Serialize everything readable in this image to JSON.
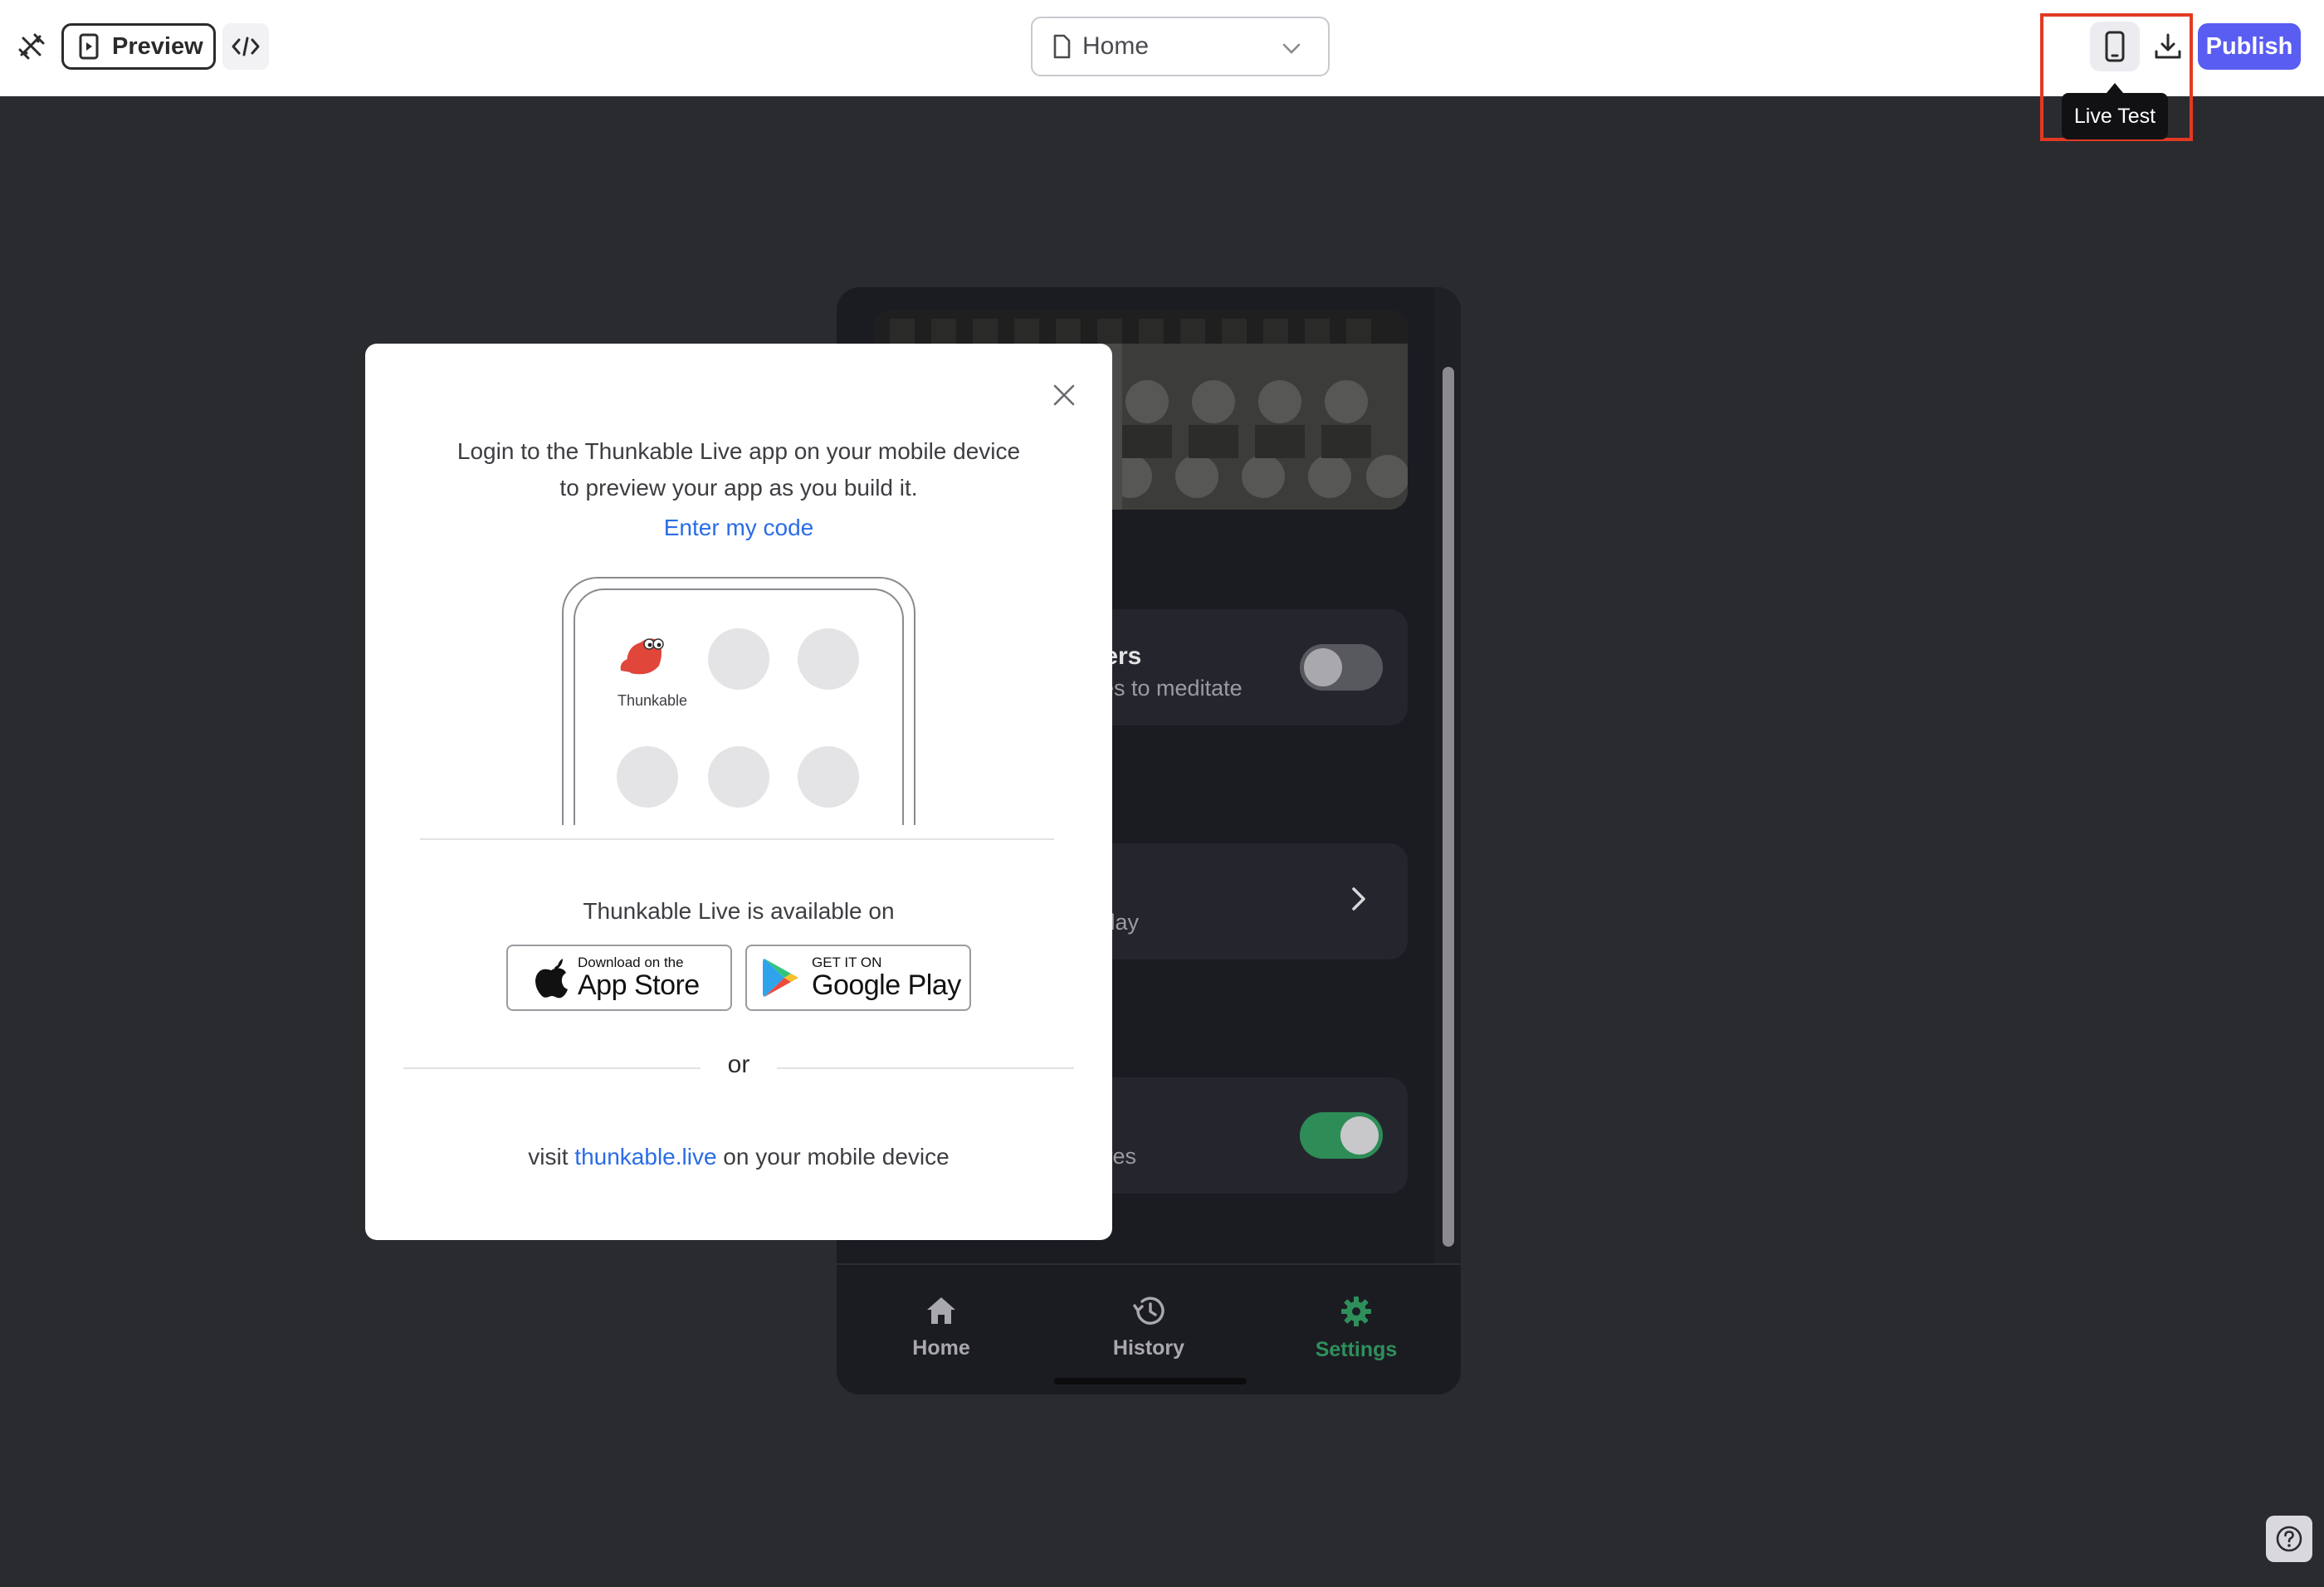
{
  "toolbar": {
    "preview_label": "Preview",
    "page_selected": "Home",
    "publish_label": "Publish",
    "livetest_tooltip": "Live Test",
    "accent_color": "#5a5df2",
    "highlight_color": "#e23a22"
  },
  "phone": {
    "cards": [
      {
        "title_fragment": "ders",
        "subtitle_fragment": "ges to meditate",
        "toggle": "off"
      },
      {
        "subtitle_fragment": "r day",
        "chevron": true
      },
      {
        "subtitle_fragment": "eyes",
        "toggle": "on"
      }
    ],
    "tabs": [
      {
        "label": "Home",
        "icon": "home-icon"
      },
      {
        "label": "History",
        "icon": "history-icon"
      },
      {
        "label": "Settings",
        "icon": "gear-icon",
        "active": true
      }
    ],
    "active_color": "#2f8f5b"
  },
  "modal": {
    "line1": "Login to the Thunkable Live app on your mobile device",
    "line2": "to preview your app as you build it.",
    "enter_code": "Enter my code",
    "illustration_app_label": "Thunkable",
    "available_text": "Thunkable Live is available on",
    "appstore": {
      "small": "Download on the",
      "big": "App Store"
    },
    "googleplay": {
      "small": "GET IT ON",
      "big": "Google Play"
    },
    "or_text": "or",
    "visit_prefix": "visit ",
    "visit_link": "thunkable.live",
    "visit_suffix": " on your mobile device",
    "link_color": "#2a6ce6"
  }
}
